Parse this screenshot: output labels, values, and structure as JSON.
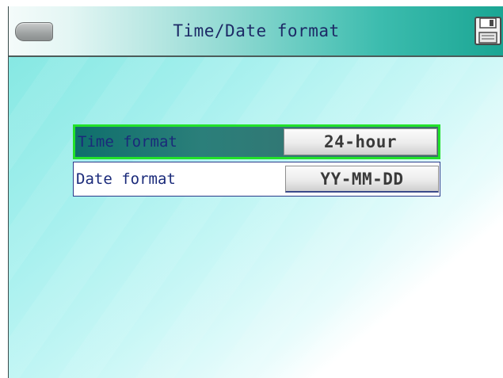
{
  "header": {
    "title": "Time/Date format",
    "back_icon": "back-pill-icon",
    "save_icon": "floppy-disk-icon"
  },
  "settings": [
    {
      "label": "Time format",
      "value": "24-hour",
      "selected": true
    },
    {
      "label": "Date format",
      "value": "YY-MM-DD",
      "selected": false
    }
  ],
  "colors": {
    "selection_border": "#22e22a",
    "title_text": "#1d2a66",
    "label_text": "#1a2a7a",
    "header_accent": "#1aa593"
  }
}
